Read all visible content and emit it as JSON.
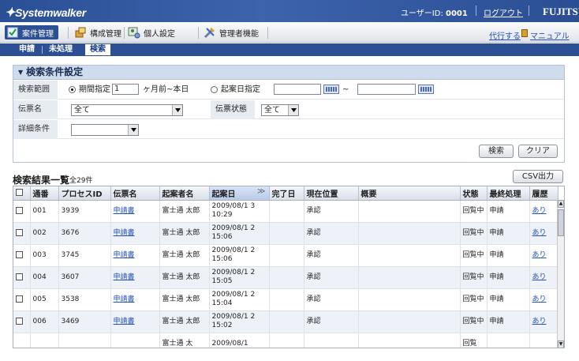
{
  "header": {
    "app_name": "Systemwalker",
    "user_id_label": "ユーザーID:",
    "user_id": "0001",
    "logout": "ログアウト",
    "brand": "FUJITSU"
  },
  "menu": {
    "items": [
      {
        "label": "案件管理",
        "icon": "check-icon",
        "active": true
      },
      {
        "label": "構成管理",
        "icon": "config-icon",
        "active": false
      },
      {
        "label": "個人設定",
        "icon": "personal-settings-icon",
        "active": false
      },
      {
        "label": "管理者機能",
        "icon": "admin-tools-icon",
        "active": false
      }
    ],
    "proxy": "代行する",
    "manual": "マニュアル"
  },
  "subtabs": [
    {
      "label": "申請",
      "active": false
    },
    {
      "label": "未処理",
      "active": false
    },
    {
      "label": "検索",
      "active": true
    }
  ],
  "search": {
    "title": "検索条件設定",
    "range_label": "検索範囲",
    "period_option": "期間指定",
    "period_value": "1",
    "period_suffix": "ヶ月前~本日",
    "date_option": "起案日指定",
    "tilde": "~",
    "slip_name_label": "伝票名",
    "slip_name_value": "全て",
    "slip_status_label": "伝票状態",
    "slip_status_value": "全て",
    "detail_label": "詳細条件",
    "detail_value": "",
    "search_button": "検索",
    "clear_button": "クリア"
  },
  "results": {
    "title": "検索結果一覧",
    "count": "全29件",
    "csv_button": "CSV出力",
    "columns": [
      "通番",
      "プロセスID",
      "伝票名",
      "起案者名",
      "起案日",
      "完了日",
      "現在位置",
      "概要",
      "状態",
      "最終処理",
      "履歴"
    ],
    "sorted_mark": "≫",
    "rows": [
      {
        "no": "001",
        "pid": "3939",
        "slip": "申請書",
        "author": "富士通 太郎",
        "date": "2009/08/1 3 10:29",
        "done": "",
        "pos": "承認",
        "summary": "",
        "state": "回覧中",
        "last": "申請",
        "hist": "あり"
      },
      {
        "no": "002",
        "pid": "3676",
        "slip": "申請書",
        "author": "富士通 太郎",
        "date": "2009/08/1 2 15:06",
        "done": "",
        "pos": "承認",
        "summary": "",
        "state": "回覧中",
        "last": "申請",
        "hist": "あり"
      },
      {
        "no": "003",
        "pid": "3745",
        "slip": "申請書",
        "author": "富士通 太郎",
        "date": "2009/08/1 2 15:06",
        "done": "",
        "pos": "承認",
        "summary": "",
        "state": "回覧中",
        "last": "申請",
        "hist": "あり"
      },
      {
        "no": "004",
        "pid": "3607",
        "slip": "申請書",
        "author": "富士通 太郎",
        "date": "2009/08/1 2 15:05",
        "done": "",
        "pos": "承認",
        "summary": "",
        "state": "回覧中",
        "last": "申請",
        "hist": "あり"
      },
      {
        "no": "005",
        "pid": "3538",
        "slip": "申請書",
        "author": "富士通 太郎",
        "date": "2009/08/1 2 15:04",
        "done": "",
        "pos": "承認",
        "summary": "",
        "state": "回覧中",
        "last": "申請",
        "hist": "あり"
      },
      {
        "no": "006",
        "pid": "3469",
        "slip": "申請書",
        "author": "富士通 太郎",
        "date": "2009/08/1 2 15:02",
        "done": "",
        "pos": "承認",
        "summary": "",
        "state": "回覧中",
        "last": "申請",
        "hist": "あり"
      },
      {
        "no": "",
        "pid": "",
        "slip": "",
        "author": "富士通 太",
        "date": "2009/08/1",
        "done": "",
        "pos": "",
        "summary": "",
        "state": "回覧",
        "last": "",
        "hist": ""
      }
    ]
  }
}
